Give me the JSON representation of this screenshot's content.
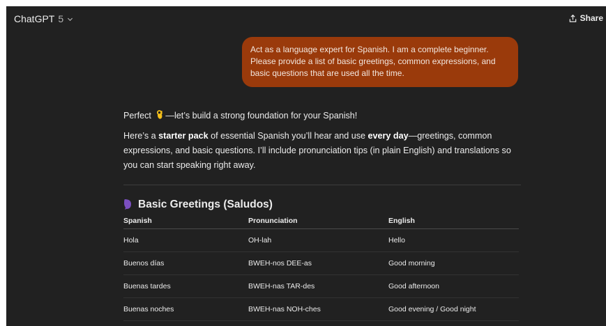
{
  "header": {
    "model_name": "ChatGPT",
    "model_version": "5",
    "share_label": "Share"
  },
  "conversation": {
    "user_message": "Act as a language expert for Spanish. I am a complete beginner. Please provide a list of basic greetings, common expressions, and basic questions that are used all the time.",
    "assistant": {
      "intro_before_emoji": "Perfect",
      "intro_after_emoji": "—let’s build a strong foundation for your Spanish!",
      "para_1": "Here’s a ",
      "para_bold_1": "starter pack",
      "para_2": " of essential Spanish you’ll hear and use ",
      "para_bold_2": "every day",
      "para_3": "—greetings, common expressions, and basic questions. I’ll include pronunciation tips (in plain English) and translations so you can start speaking right away.",
      "section_title": "Basic Greetings (Saludos)",
      "table": {
        "headers": [
          "Spanish",
          "Pronunciation",
          "English"
        ],
        "rows": [
          [
            "Hola",
            "OH-lah",
            "Hello"
          ],
          [
            "Buenos días",
            "BWEH-nos DEE-as",
            "Good morning"
          ],
          [
            "Buenas tardes",
            "BWEH-nas TAR-des",
            "Good afternoon"
          ],
          [
            "Buenas noches",
            "BWEH-nas NOH-ches",
            "Good evening / Good night"
          ]
        ]
      }
    }
  },
  "icons": {
    "model_dropdown": "chevron-down-icon",
    "share": "share-icon",
    "intro_emoji": "ok-hand-emoji-icon",
    "section_emoji": "speech-bubble-emoji-icon"
  },
  "colors": {
    "background": "#212121",
    "user_bubble": "#9a3a0b",
    "text": "#ececec"
  }
}
